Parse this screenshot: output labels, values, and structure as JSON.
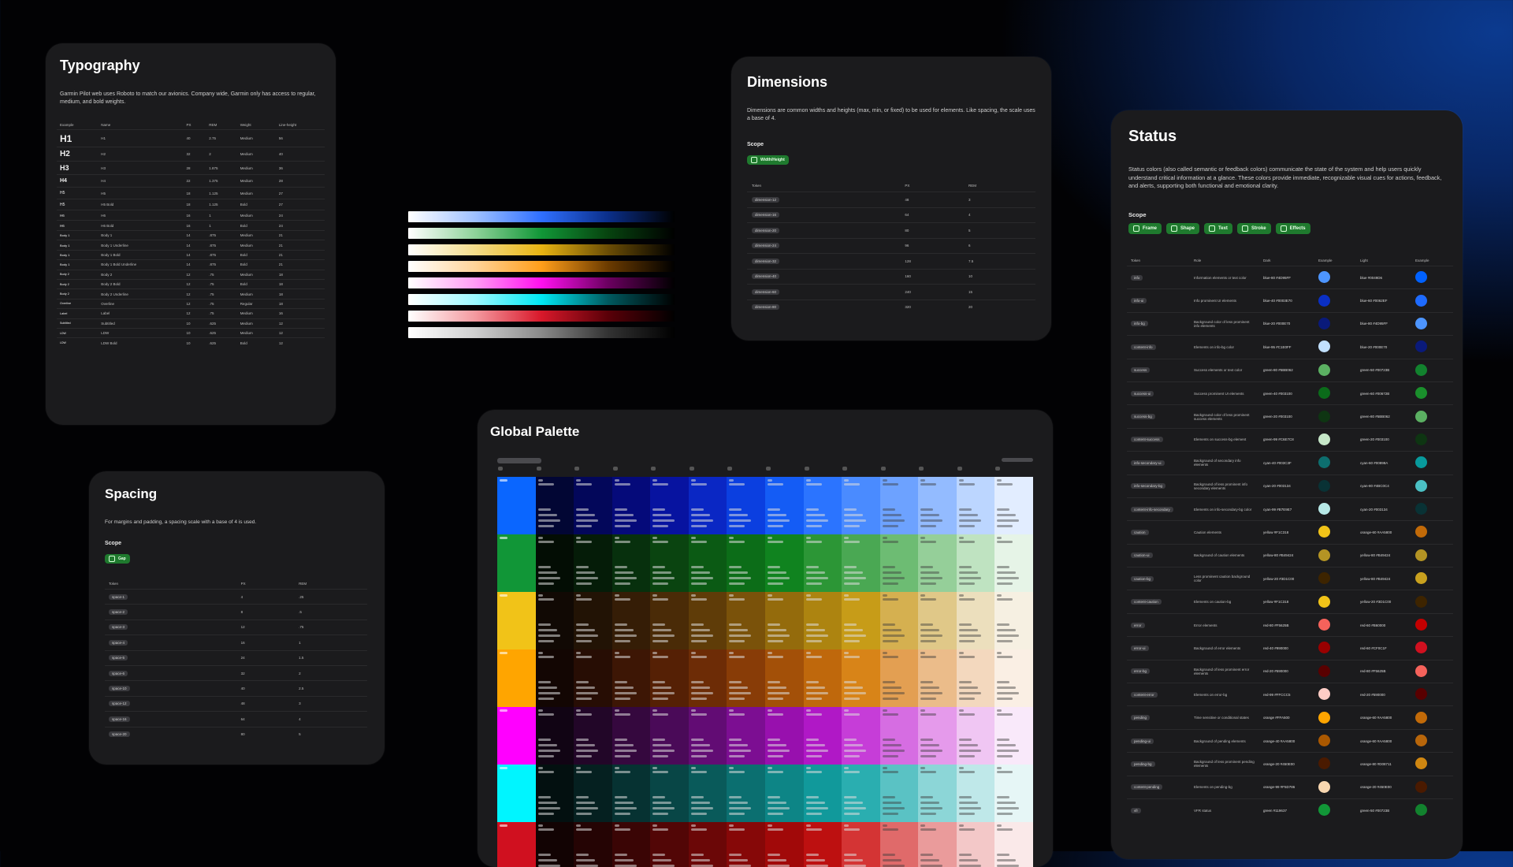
{
  "typography": {
    "title": "Typography",
    "description": "Garmin Pilot web uses Roboto to match our avionics. Company wide, Garmin only has access to regular, medium, and bold weights.",
    "columns": [
      "Example",
      "Name",
      "PX",
      "REM",
      "Weight",
      "Line-height"
    ],
    "rows": [
      {
        "example": "H1",
        "name": "H1",
        "px": "40",
        "rem": "2.75",
        "weight": "Medium",
        "lh": "56",
        "size": 12
      },
      {
        "example": "H2",
        "name": "H2",
        "px": "32",
        "rem": "2",
        "weight": "Medium",
        "lh": "40",
        "size": 10
      },
      {
        "example": "H3",
        "name": "H3",
        "px": "28",
        "rem": "1.875",
        "weight": "Medium",
        "lh": "36",
        "size": 9
      },
      {
        "example": "H4",
        "name": "H4",
        "px": "22",
        "rem": "1.375",
        "weight": "Medium",
        "lh": "28",
        "size": 7
      },
      {
        "example": "H5",
        "name": "H5",
        "px": "18",
        "rem": "1.125",
        "weight": "Medium",
        "lh": "27",
        "size": 5
      },
      {
        "example": "H5",
        "name": "H5 Bold",
        "px": "18",
        "rem": "1.125",
        "weight": "Bold",
        "lh": "27",
        "size": 5
      },
      {
        "example": "H6",
        "name": "H6",
        "px": "16",
        "rem": "1",
        "weight": "Medium",
        "lh": "24",
        "size": 4.5
      },
      {
        "example": "H6",
        "name": "H6 Bold",
        "px": "16",
        "rem": "1",
        "weight": "Bold",
        "lh": "24",
        "size": 4.5
      },
      {
        "example": "Body 1",
        "name": "Body 1",
        "px": "14",
        "rem": ".875",
        "weight": "Medium",
        "lh": "21",
        "size": 4
      },
      {
        "example": "Body 1",
        "name": "Body 1 Underline",
        "px": "14",
        "rem": ".875",
        "weight": "Medium",
        "lh": "21",
        "size": 4
      },
      {
        "example": "Body 1",
        "name": "Body 1 Bold",
        "px": "14",
        "rem": ".875",
        "weight": "Bold",
        "lh": "21",
        "size": 4
      },
      {
        "example": "Body 1",
        "name": "Body 1 Bold Underline",
        "px": "14",
        "rem": ".875",
        "weight": "Bold",
        "lh": "21",
        "size": 4
      },
      {
        "example": "Body 2",
        "name": "Body 2",
        "px": "12",
        "rem": ".75",
        "weight": "Medium",
        "lh": "18",
        "size": 3.8
      },
      {
        "example": "Body 2",
        "name": "Body 2 Bold",
        "px": "12",
        "rem": ".75",
        "weight": "Bold",
        "lh": "18",
        "size": 3.8
      },
      {
        "example": "Body 2",
        "name": "Body 2 Underline",
        "px": "12",
        "rem": ".75",
        "weight": "Medium",
        "lh": "18",
        "size": 3.8
      },
      {
        "example": "Overline",
        "name": "Overline",
        "px": "12",
        "rem": ".75",
        "weight": "Regular",
        "lh": "18",
        "size": 3.8
      },
      {
        "example": "Label",
        "name": "Label",
        "px": "12",
        "rem": ".75",
        "weight": "Medium",
        "lh": "16",
        "size": 3.8
      },
      {
        "example": "Subtitled",
        "name": "Subtitled",
        "px": "10",
        "rem": ".625",
        "weight": "Medium",
        "lh": "12",
        "size": 3.5
      },
      {
        "example": "LDW",
        "name": "LDW",
        "px": "10",
        "rem": ".625",
        "weight": "Medium",
        "lh": "12",
        "size": 3.5
      },
      {
        "example": "LDW",
        "name": "LDW Bold",
        "px": "10",
        "rem": ".625",
        "weight": "Bold",
        "lh": "12",
        "size": 3.5
      }
    ]
  },
  "spacing": {
    "title": "Spacing",
    "description": "For margins and padding, a spacing scale with a base of 4 is used.",
    "scope_label": "Scope",
    "chips": [
      "Gap"
    ],
    "columns": [
      "Token",
      "PX",
      "REM"
    ],
    "rows": [
      {
        "token": "space-1",
        "px": "4",
        "rem": ".25"
      },
      {
        "token": "space-2",
        "px": "8",
        "rem": ".5"
      },
      {
        "token": "space-3",
        "px": "12",
        "rem": ".75"
      },
      {
        "token": "space-4",
        "px": "16",
        "rem": "1"
      },
      {
        "token": "space-5",
        "px": "24",
        "rem": "1.5"
      },
      {
        "token": "space-6",
        "px": "32",
        "rem": "2"
      },
      {
        "token": "space-10",
        "px": "40",
        "rem": "2.5"
      },
      {
        "token": "space-12",
        "px": "48",
        "rem": "3"
      },
      {
        "token": "space-16",
        "px": "64",
        "rem": "4"
      },
      {
        "token": "space-20",
        "px": "80",
        "rem": "5"
      }
    ]
  },
  "dimensions": {
    "title": "Dimensions",
    "description": "Dimensions are common widths and heights (max, min, or fixed) to be used for elements. Like spacing, the scale uses a base of 4.",
    "scope_label": "Scope",
    "chips": [
      "Width/Height"
    ],
    "columns": [
      "Token",
      "PX",
      "REM"
    ],
    "rows": [
      {
        "token": "dimension-12",
        "px": "48",
        "rem": "3"
      },
      {
        "token": "dimension-16",
        "px": "64",
        "rem": "4"
      },
      {
        "token": "dimension-20",
        "px": "80",
        "rem": "5"
      },
      {
        "token": "dimension-24",
        "px": "96",
        "rem": "6"
      },
      {
        "token": "dimension-32",
        "px": "128",
        "rem": "7.5"
      },
      {
        "token": "dimension-40",
        "px": "160",
        "rem": "10"
      },
      {
        "token": "dimension-60",
        "px": "240",
        "rem": "15"
      },
      {
        "token": "dimension-80",
        "px": "320",
        "rem": "20"
      }
    ]
  },
  "status": {
    "title": "Status",
    "description": "Status colors (also called semantic or feedback colors) communicate the state of the system and help users quickly understand critical information at a glance. These colors provide immediate, recognizable visual cues for actions, feedback, and alerts, supporting both functional and emotional clarity.",
    "scope_label": "Scope",
    "chips": [
      "Frame",
      "Shape",
      "Text",
      "Stroke",
      "Effects"
    ],
    "columns": [
      "Token",
      "Role",
      "Dark",
      "Example",
      "Light",
      "Example"
    ],
    "rows": [
      {
        "token": "info",
        "role": "Information elements or text color",
        "dark": "blue-80 #4D95FF",
        "dark_hex": "#4D95FF",
        "light": "blue #0049D6",
        "light_hex": "#0061FF"
      },
      {
        "token": "info-ui",
        "role": "Info prominent UI elements",
        "dark": "blue-40 #0003E70",
        "dark_hex": "#0A2FC4",
        "light": "blue-60 #0062EF",
        "light_hex": "#1E6BFF"
      },
      {
        "token": "info-bg",
        "role": "Background color of less prominent info elements",
        "dark": "blue-20 #000E70",
        "dark_hex": "#0A1A7A",
        "light": "blue-80 #4D95FF",
        "light_hex": "#4D95FF"
      },
      {
        "token": "content-info",
        "role": "Elements on info-bg color",
        "dark": "blue-95 #C1E0FF",
        "dark_hex": "#C1E0FF",
        "light": "blue-20 #000E70",
        "light_hex": "#0A1A7A"
      },
      {
        "token": "success",
        "role": "Success elements or text color",
        "dark": "green-80 #5BB062",
        "dark_hex": "#5BB062",
        "light": "green-50 #00723B",
        "light_hex": "#12822E"
      },
      {
        "token": "success-ui",
        "role": "Success prominent UI elements",
        "dark": "green-40 #003100",
        "dark_hex": "#0B6B1A",
        "light": "green-60 #00672B",
        "light_hex": "#1A8F2C"
      },
      {
        "token": "success-bg",
        "role": "Background color of less prominent success elements",
        "dark": "green-20 #003100",
        "dark_hex": "#0E3512",
        "light": "green-80 #5BB062",
        "light_hex": "#5BB062"
      },
      {
        "token": "content-success",
        "role": "Elements on success-bg element",
        "dark": "green-99 #C6E7C8",
        "dark_hex": "#C6E7C8",
        "light": "green-20 #003100",
        "light_hex": "#0E3512"
      },
      {
        "token": "info-secondary-ui",
        "role": "Background of secondary info elements",
        "dark": "cyan-40 #003C3F",
        "dark_hex": "#0D6E6E",
        "light": "cyan-60 #00898A",
        "light_hex": "#089A9C"
      },
      {
        "token": "info-secondary-bg",
        "role": "Background of less prominent info secondary elements",
        "dark": "cyan-20 #003134",
        "dark_hex": "#093235",
        "light": "cyan-80 #4BC0C4",
        "light_hex": "#4BC0C4"
      },
      {
        "token": "content-info-secondary",
        "role": "Elements on info-secondary-bg color",
        "dark": "cyan-99 #B7E9E7",
        "dark_hex": "#B7E9E7",
        "light": "cyan-20 #003134",
        "light_hex": "#093235"
      },
      {
        "token": "caution",
        "role": "Caution elements",
        "dark": "yellow #F1C318",
        "dark_hex": "#F1C318",
        "light": "orange-60 #AA5800",
        "light_hex": "#C26A08"
      },
      {
        "token": "caution-ui",
        "role": "Background of caution elements",
        "dark": "yellow-80 #B49424",
        "dark_hex": "#B49424",
        "light": "yellow-80 #B49424",
        "light_hex": "#B49424"
      },
      {
        "token": "caution-bg",
        "role": "Less prominent caution background color",
        "dark": "yellow-20 #3D1C00",
        "dark_hex": "#3D2400",
        "light": "yellow-80 #B49424",
        "light_hex": "#C9A11E"
      },
      {
        "token": "content-caution",
        "role": "Elements on caution-bg",
        "dark": "yellow #F1C318",
        "dark_hex": "#F1C318",
        "light": "yellow-20 #3D1C00",
        "light_hex": "#3D2400"
      },
      {
        "token": "error",
        "role": "Error elements",
        "dark": "red-80 #F5625B",
        "dark_hex": "#F5625B",
        "light": "red-60 #B60000",
        "light_hex": "#C40000"
      },
      {
        "token": "error-ui",
        "role": "Background of error elements",
        "dark": "red-40 #990000",
        "dark_hex": "#990000",
        "light": "red-60 #CF0C1F",
        "light_hex": "#D0101F"
      },
      {
        "token": "error-bg",
        "role": "Background of less prominent error elements",
        "dark": "red-20 #590000",
        "dark_hex": "#590000",
        "light": "red-80 #F5625B",
        "light_hex": "#F5625B"
      },
      {
        "token": "content-error",
        "role": "Elements on error-bg",
        "dark": "red-99 #FFCCC5",
        "dark_hex": "#FFCCC5",
        "light": "red-20 #590000",
        "light_hex": "#590000"
      },
      {
        "token": "pending",
        "role": "Time sensitive or conditional states",
        "dark": "orange #FFA500",
        "dark_hex": "#FFA500",
        "light": "orange-60 #AA5800",
        "light_hex": "#C26A08"
      },
      {
        "token": "pending-ui",
        "role": "Background of pending elements",
        "dark": "orange-40 #AA5800",
        "dark_hex": "#AA5800",
        "light": "orange-60 #AA5800",
        "light_hex": "#B8660A"
      },
      {
        "token": "pending-bg",
        "role": "Background of less prominent pending elements",
        "dark": "orange-20 #450E00",
        "dark_hex": "#4A1A00",
        "light": "orange-80 #D08711",
        "light_hex": "#D08711"
      },
      {
        "token": "content-pending",
        "role": "Elements on pending-bg",
        "dark": "orange-99 #F5D786",
        "dark_hex": "#F8D7B0",
        "light": "orange-20 #450E00",
        "light_hex": "#4A1A00"
      },
      {
        "token": "vfr",
        "role": "VFR status",
        "dark": "green #119637",
        "dark_hex": "#119637",
        "light": "green-50 #00723B",
        "light_hex": "#12822E"
      }
    ]
  },
  "palette": {
    "title": "Global Palette",
    "rows": [
      {
        "name": "blue",
        "base": "#0a66ff",
        "ramp": [
          "#020634",
          "#03075a",
          "#050a7a",
          "#0713a0",
          "#0a27c4",
          "#0b3fe0",
          "#145cf5",
          "#2b74ff",
          "#4a8bff",
          "#6da2ff",
          "#93bbff",
          "#bcd6ff",
          "#e2edff"
        ]
      },
      {
        "name": "green",
        "base": "#119637",
        "ramp": [
          "#030d04",
          "#051c08",
          "#07300d",
          "#0a4410",
          "#0b5a14",
          "#0c6d18",
          "#10831f",
          "#2c9636",
          "#4aa853",
          "#6dbc73",
          "#95cf99",
          "#bfe3c1",
          "#e6f4e7"
        ]
      },
      {
        "name": "yellow",
        "base": "#f1c318",
        "ramp": [
          "#110904",
          "#221305",
          "#351d06",
          "#4a2b07",
          "#5f3c08",
          "#7a520a",
          "#946b0c",
          "#ad8410",
          "#c79c18",
          "#d5b050",
          "#e0c888",
          "#ecdfbd",
          "#f6f0e2"
        ]
      },
      {
        "name": "orange",
        "base": "#ffa500",
        "ramp": [
          "#130603",
          "#270d04",
          "#3d1605",
          "#552005",
          "#6d2c06",
          "#883c07",
          "#a35008",
          "#bf680c",
          "#d88418",
          "#e39f52",
          "#ebbc8a",
          "#f3d8be",
          "#faefe4"
        ]
      },
      {
        "name": "magenta",
        "base": "#ff00ff",
        "ramp": [
          "#110414",
          "#220628",
          "#35083e",
          "#4a0a58",
          "#620c74",
          "#7c0e92",
          "#9810ae",
          "#b018c6",
          "#c63dd8",
          "#d66de2",
          "#e59aeb",
          "#f0c6f3",
          "#f9e9fa"
        ]
      },
      {
        "name": "cyan",
        "base": "#00f5ff",
        "ramp": [
          "#031010",
          "#052020",
          "#063232",
          "#084646",
          "#095a5a",
          "#0b6f70",
          "#0d8586",
          "#11999b",
          "#2aaeb0",
          "#5ac2c4",
          "#8cd6d7",
          "#bfe8e9",
          "#e6f6f6"
        ]
      },
      {
        "name": "red",
        "base": "#d0101f",
        "ramp": [
          "#120303",
          "#250404",
          "#3a0505",
          "#520606",
          "#6b0707",
          "#860808",
          "#a10909",
          "#bd1010",
          "#d43434",
          "#e06a6a",
          "#ea9b9b",
          "#f3c8c8",
          "#fae9e9"
        ]
      }
    ]
  },
  "gradients": [
    [
      "#ffffff",
      "#9fc1ff",
      "#2f6fff",
      "#0b2f8a",
      "#000000"
    ],
    [
      "#ffffff",
      "#8fd39a",
      "#119637",
      "#07430f",
      "#000000"
    ],
    [
      "#ffffff",
      "#f4dc8a",
      "#e8b412",
      "#6b4d05",
      "#000000"
    ],
    [
      "#ffffff",
      "#ffd49a",
      "#ff9e1a",
      "#6b3b00",
      "#000000"
    ],
    [
      "#ffffff",
      "#ff9cf4",
      "#ff10ee",
      "#6b0060",
      "#000000"
    ],
    [
      "#ffffff",
      "#9cf8ff",
      "#00e8f4",
      "#005a60",
      "#000000"
    ],
    [
      "#ffffff",
      "#f49aa0",
      "#d8182a",
      "#5a0008",
      "#000000"
    ],
    [
      "#ffffff",
      "#cfcfcf",
      "#8a8a8a",
      "#333333",
      "#000000"
    ]
  ]
}
